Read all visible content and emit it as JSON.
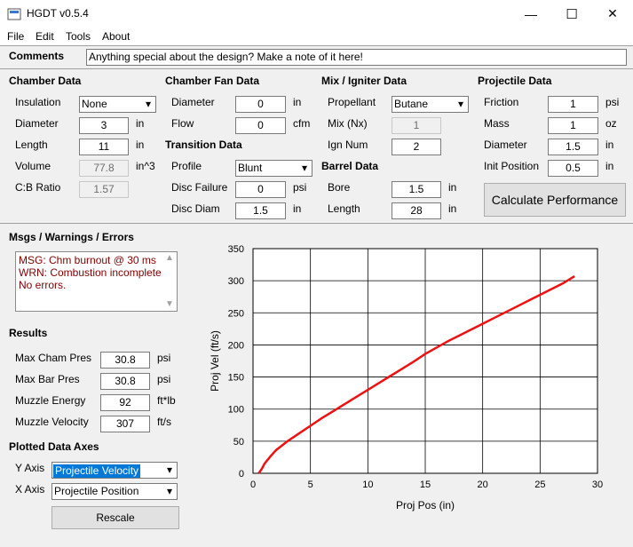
{
  "app": {
    "title": "HGDT v0.5.4"
  },
  "window": {
    "minimize": "—",
    "maximize": "☐",
    "close": "✕"
  },
  "menu": [
    "File",
    "Edit",
    "Tools",
    "About"
  ],
  "comments": {
    "label": "Comments",
    "value": "Anything special about the design?  Make a note of it here!"
  },
  "chamber": {
    "header": "Chamber Data",
    "insulation_label": "Insulation",
    "insulation": "None",
    "diameter_label": "Diameter",
    "diameter": "3",
    "diameter_unit": "in",
    "length_label": "Length",
    "length": "11",
    "length_unit": "in",
    "volume_label": "Volume",
    "volume": "77.8",
    "volume_unit": "in^3",
    "cb_label": "C:B Ratio",
    "cb": "1.57"
  },
  "fan": {
    "header": "Chamber Fan Data",
    "diameter_label": "Diameter",
    "diameter": "0",
    "diameter_unit": "in",
    "flow_label": "Flow",
    "flow": "0",
    "flow_unit": "cfm"
  },
  "transition": {
    "header": "Transition Data",
    "profile_label": "Profile",
    "profile": "Blunt",
    "disc_failure_label": "Disc Failure",
    "disc_failure": "0",
    "disc_failure_unit": "psi",
    "disc_diam_label": "Disc Diam",
    "disc_diam": "1.5",
    "disc_diam_unit": "in"
  },
  "mix": {
    "header": "Mix / Igniter Data",
    "propellant_label": "Propellant",
    "propellant": "Butane",
    "mix_label": "Mix (Nx)",
    "mix": "1",
    "ign_label": "Ign Num",
    "ign": "2"
  },
  "barrel": {
    "header": "Barrel Data",
    "bore_label": "Bore",
    "bore": "1.5",
    "bore_unit": "in",
    "length_label": "Length",
    "length": "28",
    "length_unit": "in"
  },
  "projectile": {
    "header": "Projectile Data",
    "friction_label": "Friction",
    "friction": "1",
    "friction_unit": "psi",
    "mass_label": "Mass",
    "mass": "1",
    "mass_unit": "oz",
    "diameter_label": "Diameter",
    "diameter": "1.5",
    "diameter_unit": "in",
    "init_label": "Init Position",
    "init": "0.5",
    "init_unit": "in"
  },
  "calculate_label": "Calculate Performance",
  "messages": {
    "header": "Msgs / Warnings / Errors",
    "lines": [
      "MSG: Chm burnout @ 30 ms",
      "WRN: Combustion incomplete",
      "No errors."
    ]
  },
  "results": {
    "header": "Results",
    "max_cham_label": "Max Cham Pres",
    "max_cham": "30.8",
    "max_cham_unit": "psi",
    "max_bar_label": "Max Bar Pres",
    "max_bar": "30.8",
    "max_bar_unit": "psi",
    "energy_label": "Muzzle Energy",
    "energy": "92",
    "energy_unit": "ft*lb",
    "velocity_label": "Muzzle Velocity",
    "velocity": "307",
    "velocity_unit": "ft/s"
  },
  "axes": {
    "header": "Plotted Data Axes",
    "y_label": "Y Axis",
    "y_value": "Projectile Velocity",
    "x_label": "X Axis",
    "x_value": "Projectile Position",
    "rescale_label": "Rescale"
  },
  "chart_data": {
    "type": "line",
    "xlabel": "Proj Pos (in)",
    "ylabel": "Proj Vel (ft/s)",
    "xlim": [
      0,
      30
    ],
    "ylim": [
      0,
      350
    ],
    "xticks": [
      0,
      5,
      10,
      15,
      20,
      25,
      30
    ],
    "yticks": [
      0,
      50,
      100,
      150,
      200,
      250,
      300,
      350
    ],
    "grid": true,
    "series_color": "#ee1111",
    "x": [
      0.5,
      0.8,
      1,
      1.5,
      2,
      3,
      4,
      5,
      6,
      7,
      8,
      9,
      10,
      11,
      12,
      13,
      14,
      15,
      16,
      17,
      18,
      19,
      20,
      21,
      22,
      23,
      24,
      25,
      26,
      27,
      28
    ],
    "y": [
      0,
      8,
      15,
      26,
      36,
      50,
      62,
      74,
      86,
      97,
      108,
      119,
      130,
      141,
      152,
      163,
      174,
      186,
      196,
      206,
      215,
      224,
      233,
      242,
      251,
      260,
      269,
      278,
      287,
      296,
      307
    ]
  }
}
